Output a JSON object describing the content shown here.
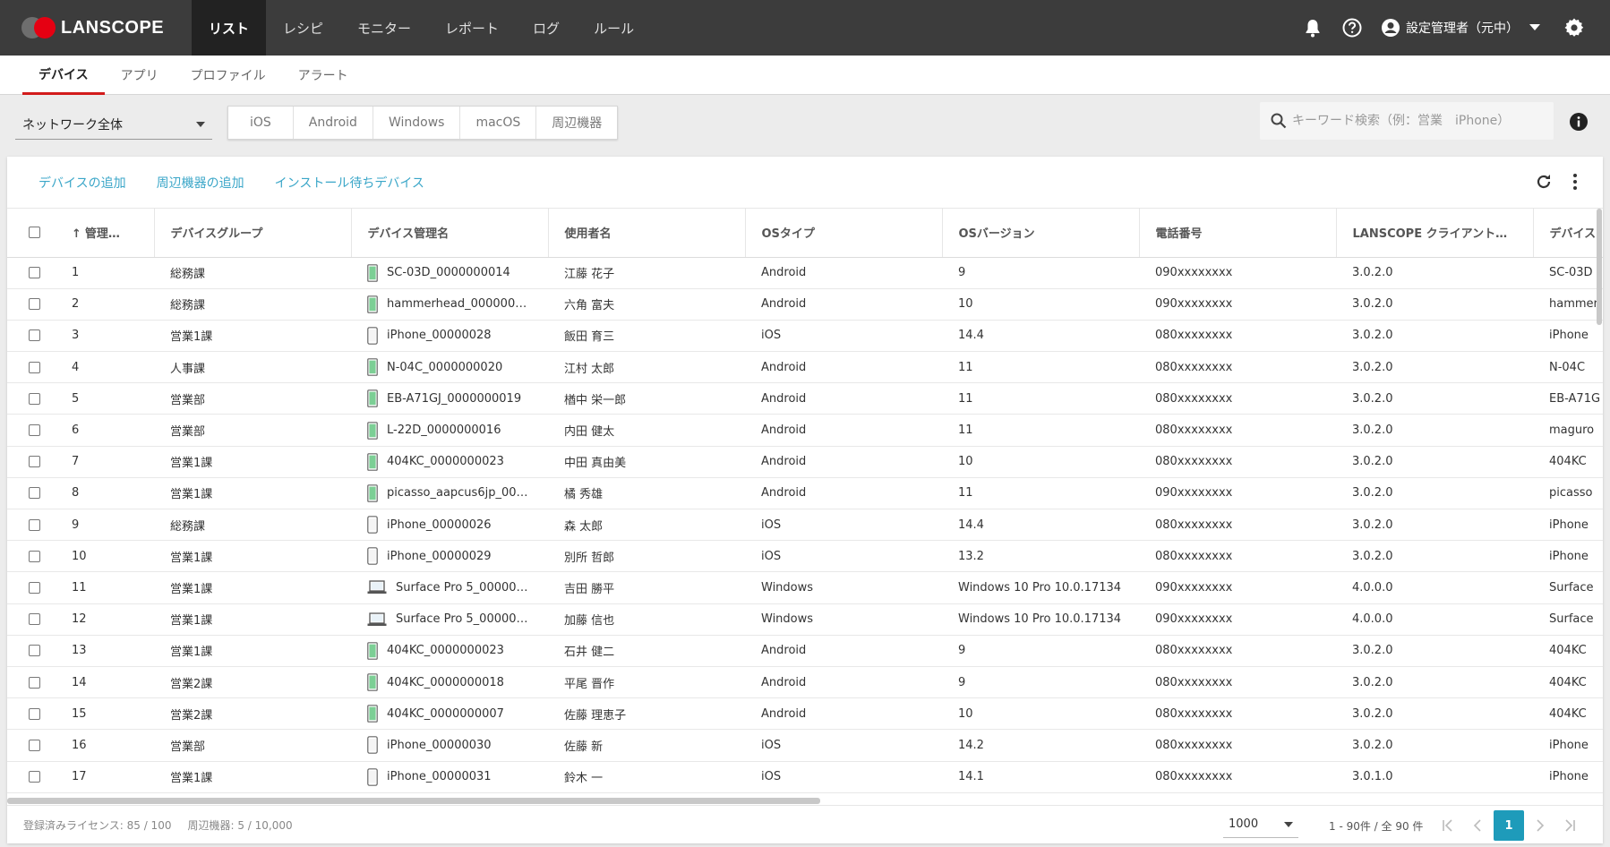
{
  "brand": {
    "name": "LANSCOPE"
  },
  "nav": [
    "リスト",
    "レシピ",
    "モニター",
    "レポート",
    "ログ",
    "ルール"
  ],
  "user": {
    "name": "設定管理者（元中）"
  },
  "subtabs": [
    "デバイス",
    "アプリ",
    "プロファイル",
    "アラート"
  ],
  "filter": {
    "network": "ネットワーク全体",
    "os": [
      "iOS",
      "Android",
      "Windows",
      "macOS",
      "周辺機器"
    ]
  },
  "search": {
    "placeholder": "キーワード検索（例：営業　iPhone）"
  },
  "actions": [
    "デバイスの追加",
    "周辺機器の追加",
    "インストール待ちデバイス"
  ],
  "columns": [
    "管理…",
    "デバイスグループ",
    "デバイス管理名",
    "使用者名",
    "OSタイプ",
    "OSバージョン",
    "電話番号",
    "LANSCOPE クライアント…",
    "デバイス"
  ],
  "rows": [
    {
      "id": "1",
      "group": "総務課",
      "name": "SC-03D_0000000014",
      "user": "江藤 花子",
      "os": "Android",
      "ver": "9",
      "phone": "090xxxxxxxx",
      "client": "3.0.2.0",
      "model": "SC-03D",
      "icon": "android-phone-icon"
    },
    {
      "id": "2",
      "group": "総務課",
      "name": "hammerhead_00000000…",
      "user": "六角 富夫",
      "os": "Android",
      "ver": "10",
      "phone": "090xxxxxxxx",
      "client": "3.0.2.0",
      "model": "hammer",
      "icon": "android-phone-icon"
    },
    {
      "id": "3",
      "group": "営業1課",
      "name": "iPhone_00000028",
      "user": "飯田 育三",
      "os": "iOS",
      "ver": "14.4",
      "phone": "080xxxxxxxx",
      "client": "3.0.2.0",
      "model": "iPhone",
      "icon": "iphone-icon"
    },
    {
      "id": "4",
      "group": "人事課",
      "name": "N-04C_0000000020",
      "user": "江村 太郎",
      "os": "Android",
      "ver": "11",
      "phone": "080xxxxxxxx",
      "client": "3.0.2.0",
      "model": "N-04C",
      "icon": "android-phone-icon"
    },
    {
      "id": "5",
      "group": "営業部",
      "name": "EB-A71GJ_0000000019",
      "user": "楢中 栄一郎",
      "os": "Android",
      "ver": "11",
      "phone": "080xxxxxxxx",
      "client": "3.0.2.0",
      "model": "EB-A71G",
      "icon": "android-phone-icon"
    },
    {
      "id": "6",
      "group": "営業部",
      "name": "L-22D_0000000016",
      "user": "内田 健太",
      "os": "Android",
      "ver": "11",
      "phone": "080xxxxxxxx",
      "client": "3.0.2.0",
      "model": "maguro",
      "icon": "android-phone-icon"
    },
    {
      "id": "7",
      "group": "営業1課",
      "name": "404KC_0000000023",
      "user": "中田 真由美",
      "os": "Android",
      "ver": "10",
      "phone": "080xxxxxxxx",
      "client": "3.0.2.0",
      "model": "404KC",
      "icon": "android-phone-icon"
    },
    {
      "id": "8",
      "group": "営業1課",
      "name": "picasso_aapcus6jp_000…",
      "user": "橘 秀雄",
      "os": "Android",
      "ver": "11",
      "phone": "090xxxxxxxx",
      "client": "3.0.2.0",
      "model": "picasso",
      "icon": "android-phone-icon"
    },
    {
      "id": "9",
      "group": "総務課",
      "name": "iPhone_00000026",
      "user": "森 太郎",
      "os": "iOS",
      "ver": "14.4",
      "phone": "080xxxxxxxx",
      "client": "3.0.2.0",
      "model": "iPhone",
      "icon": "iphone-icon"
    },
    {
      "id": "10",
      "group": "営業1課",
      "name": "iPhone_00000029",
      "user": "別所 哲郎",
      "os": "iOS",
      "ver": "13.2",
      "phone": "080xxxxxxxx",
      "client": "3.0.2.0",
      "model": "iPhone",
      "icon": "iphone-icon"
    },
    {
      "id": "11",
      "group": "営業1課",
      "name": "Surface Pro 5_0000000…",
      "user": "吉田 勝平",
      "os": "Windows",
      "ver": "Windows 10 Pro 10.0.17134",
      "phone": "090xxxxxxxx",
      "client": "4.0.0.0",
      "model": "Surface",
      "icon": "laptop-icon"
    },
    {
      "id": "12",
      "group": "営業1課",
      "name": "Surface Pro 5_0000000…",
      "user": "加藤 信也",
      "os": "Windows",
      "ver": "Windows 10 Pro 10.0.17134",
      "phone": "090xxxxxxxx",
      "client": "4.0.0.0",
      "model": "Surface",
      "icon": "laptop-icon"
    },
    {
      "id": "13",
      "group": "営業1課",
      "name": "404KC_0000000023",
      "user": "石井 健二",
      "os": "Android",
      "ver": "9",
      "phone": "080xxxxxxxx",
      "client": "3.0.2.0",
      "model": "404KC",
      "icon": "android-phone-icon"
    },
    {
      "id": "14",
      "group": "営業2課",
      "name": "404KC_0000000018",
      "user": "平尾 晋作",
      "os": "Android",
      "ver": "9",
      "phone": "080xxxxxxxx",
      "client": "3.0.2.0",
      "model": "404KC",
      "icon": "android-phone-icon"
    },
    {
      "id": "15",
      "group": "営業2課",
      "name": "404KC_0000000007",
      "user": "佐藤 理恵子",
      "os": "Android",
      "ver": "10",
      "phone": "080xxxxxxxx",
      "client": "3.0.2.0",
      "model": "404KC",
      "icon": "android-phone-icon"
    },
    {
      "id": "16",
      "group": "営業部",
      "name": "iPhone_00000030",
      "user": "佐藤 新",
      "os": "iOS",
      "ver": "14.2",
      "phone": "080xxxxxxxx",
      "client": "3.0.2.0",
      "model": "iPhone",
      "icon": "iphone-icon"
    },
    {
      "id": "17",
      "group": "営業1課",
      "name": "iPhone_00000031",
      "user": "鈴木 一",
      "os": "iOS",
      "ver": "14.1",
      "phone": "080xxxxxxxx",
      "client": "3.0.1.0",
      "model": "iPhone",
      "icon": "iphone-icon"
    }
  ],
  "footer": {
    "license": "登録済みライセンス: 85 / 100",
    "peripheral": "周辺機器: 5 / 10,000",
    "per_page": "1000",
    "range": "1 - 90件 / 全 90 件",
    "current_page": "1"
  },
  "colors": {
    "topbar": "#3c3c3c",
    "accent_red": "#e50012",
    "link": "#3aa6c8",
    "page_active": "#1e9bba",
    "android": "#7ccf95"
  }
}
